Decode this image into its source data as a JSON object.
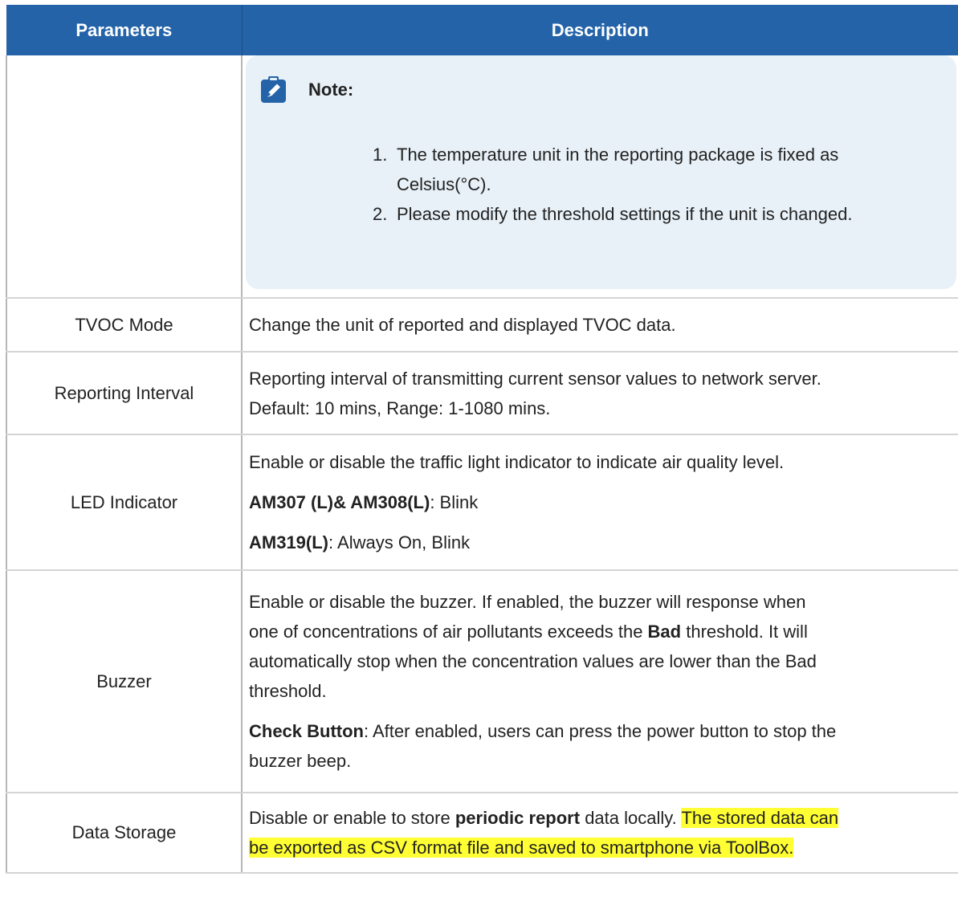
{
  "table": {
    "headers": [
      "Parameters",
      "Description"
    ],
    "note": {
      "title": "Note:",
      "items": [
        {
          "num": "1.",
          "text_a": "The temperature unit in the reporting package is fixed as",
          "text_b": "Celsius(°C)."
        },
        {
          "num": "2.",
          "text_a": "Please modify the threshold settings if the unit is changed."
        }
      ]
    },
    "rows": [
      {
        "param": "TVOC Mode",
        "desc": "Change the unit of reported and displayed TVOC data."
      },
      {
        "param": "Reporting Interval",
        "line1": "Reporting interval of transmitting current sensor values to network server.",
        "line2": "Default: 10 mins, Range: 1-1080 mins."
      },
      {
        "param": "LED Indicator",
        "p1": "Enable or disable the traffic light indicator to indicate air quality level.",
        "p2_bold": "AM307 (L)& AM308(L)",
        "p2_rest": ": Blink",
        "p3_bold": "AM319(L)",
        "p3_rest": ": Always On, Blink"
      },
      {
        "param": "Buzzer",
        "l1": "Enable or disable the buzzer. If enabled, the buzzer will response when",
        "l2a": "one of concentrations of air pollutants exceeds the ",
        "l2b": "Bad",
        "l2c": " threshold. It will",
        "l3": "automatically stop when the concentration values are lower than the Bad",
        "l4": "threshold.",
        "c_bold": "Check Button",
        "c1": ": After enabled, users can press the power button to stop the",
        "c2": "buzzer beep."
      },
      {
        "param": "Data Storage",
        "a": "Disable or enable to store ",
        "b": "periodic report",
        "c": " data locally. ",
        "h1": "The stored data can",
        "h2": "be exported as CSV format file and saved to smartphone via ToolBox."
      }
    ]
  },
  "colors": {
    "header_bg": "#2463a8",
    "note_bg": "#e8f1f8",
    "highlight": "#ffff33",
    "icon": "#2463a8"
  },
  "icons": {
    "note": "pencil-clipboard-icon"
  }
}
